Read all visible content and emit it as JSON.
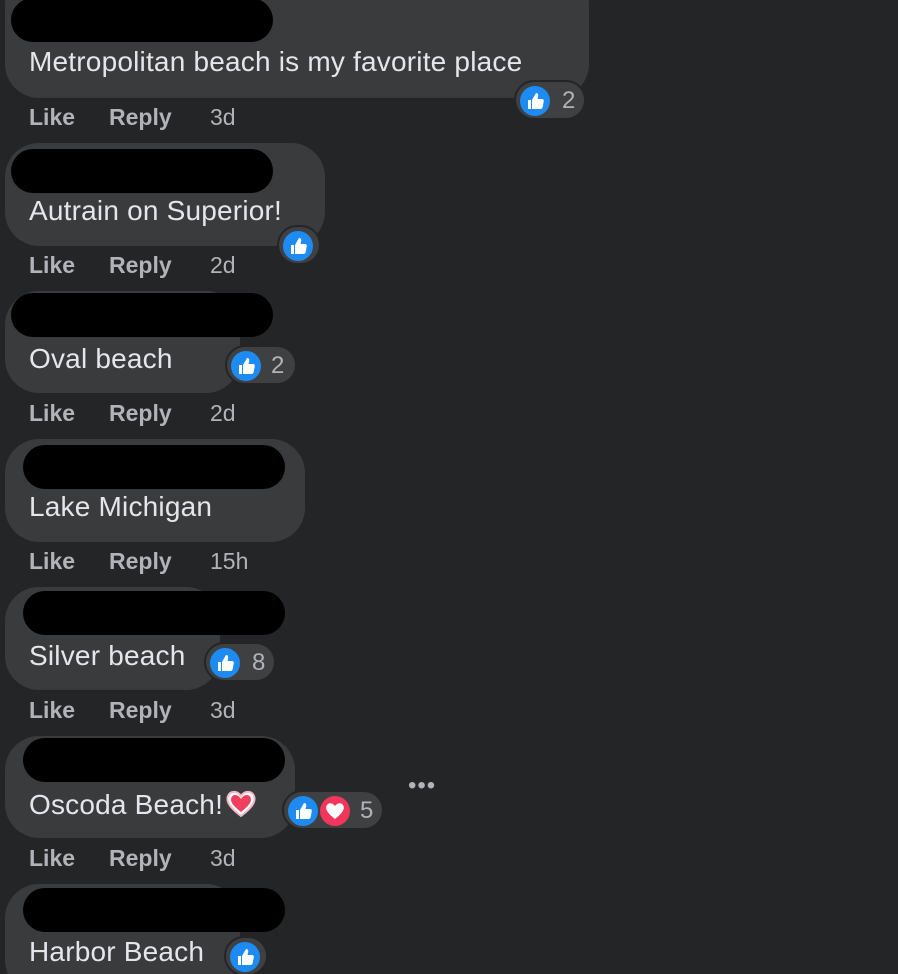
{
  "comments": [
    {
      "text": "Metropolitan beach is my favorite place",
      "reaction_count": "2",
      "time": "3d"
    },
    {
      "text": "Autrain on Superior!",
      "reaction_count": "",
      "time": "2d"
    },
    {
      "text": "Oval beach",
      "reaction_count": "2",
      "time": "2d"
    },
    {
      "text": "Lake Michigan",
      "reaction_count": "",
      "time": "15h"
    },
    {
      "text": "Silver beach",
      "reaction_count": "8",
      "time": "3d"
    },
    {
      "text": "Oscoda Beach!",
      "reaction_count": "5",
      "time": "3d",
      "emoji": "heart-emoji"
    },
    {
      "text": "Harbor Beach",
      "reaction_count": "",
      "time": ""
    }
  ],
  "actions": {
    "like_label": "Like",
    "reply_label": "Reply"
  },
  "more_label": "•••",
  "colors": {
    "background": "#242526",
    "bubble": "#3a3b3c",
    "text": "#e4e6eb",
    "secondary_text": "#b0b3b8",
    "like_blue": "#1d8bf1",
    "love_red": "#f2355a"
  },
  "icons": [
    "like-reaction-icon",
    "love-reaction-icon",
    "heart-emoji-icon",
    "more-options-icon"
  ]
}
